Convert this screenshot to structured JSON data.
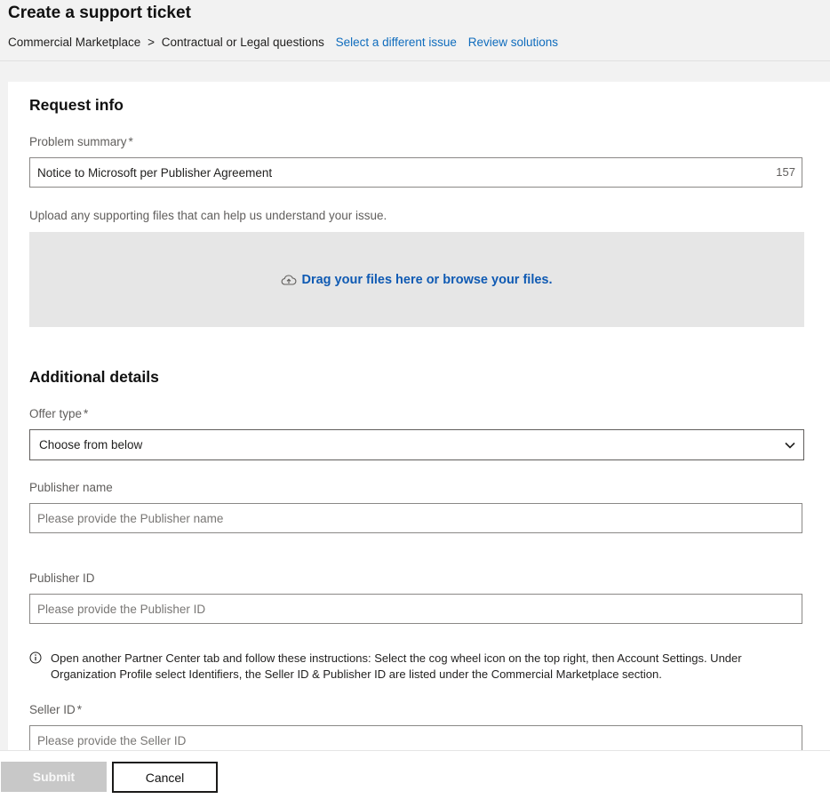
{
  "header": {
    "title": "Create a support ticket",
    "breadcrumb": {
      "category": "Commercial Marketplace",
      "separator": ">",
      "topic": "Contractual or Legal questions"
    },
    "links": {
      "select_different_issue": "Select a different issue",
      "review_solutions": "Review solutions"
    }
  },
  "request_info": {
    "title": "Request info",
    "problem_summary": {
      "label": "Problem summary",
      "required_mark": "*",
      "value": "Notice to Microsoft per Publisher Agreement",
      "char_count": "157"
    },
    "upload": {
      "label": "Upload any supporting files that can help us understand your issue.",
      "dropzone_text": "Drag your files here or browse your files.",
      "icon": "cloud-upload-icon"
    }
  },
  "additional_details": {
    "title": "Additional details",
    "offer_type": {
      "label": "Offer type",
      "required_mark": "*",
      "selected": "Choose from below",
      "icon": "chevron-down-icon"
    },
    "publisher_name": {
      "label": "Publisher name",
      "placeholder": "Please provide the Publisher name"
    },
    "publisher_id": {
      "label": "Publisher ID",
      "placeholder": "Please provide the Publisher ID"
    },
    "info_note": {
      "icon": "info-icon",
      "text": "Open another Partner Center tab and follow these instructions: Select the cog wheel icon on the top right, then Account Settings. Under Organization Profile select Identifiers, the Seller ID & Publisher ID are listed under the Commercial Marketplace section."
    },
    "seller_id": {
      "label": "Seller ID",
      "required_mark": "*",
      "placeholder": "Please provide the Seller ID"
    }
  },
  "footer": {
    "submit_label": "Submit",
    "cancel_label": "Cancel"
  },
  "colors": {
    "link": "#0f6cbd",
    "dropzone_bg": "#e6e6e6",
    "submit_disabled_bg": "#c8c8c8"
  }
}
